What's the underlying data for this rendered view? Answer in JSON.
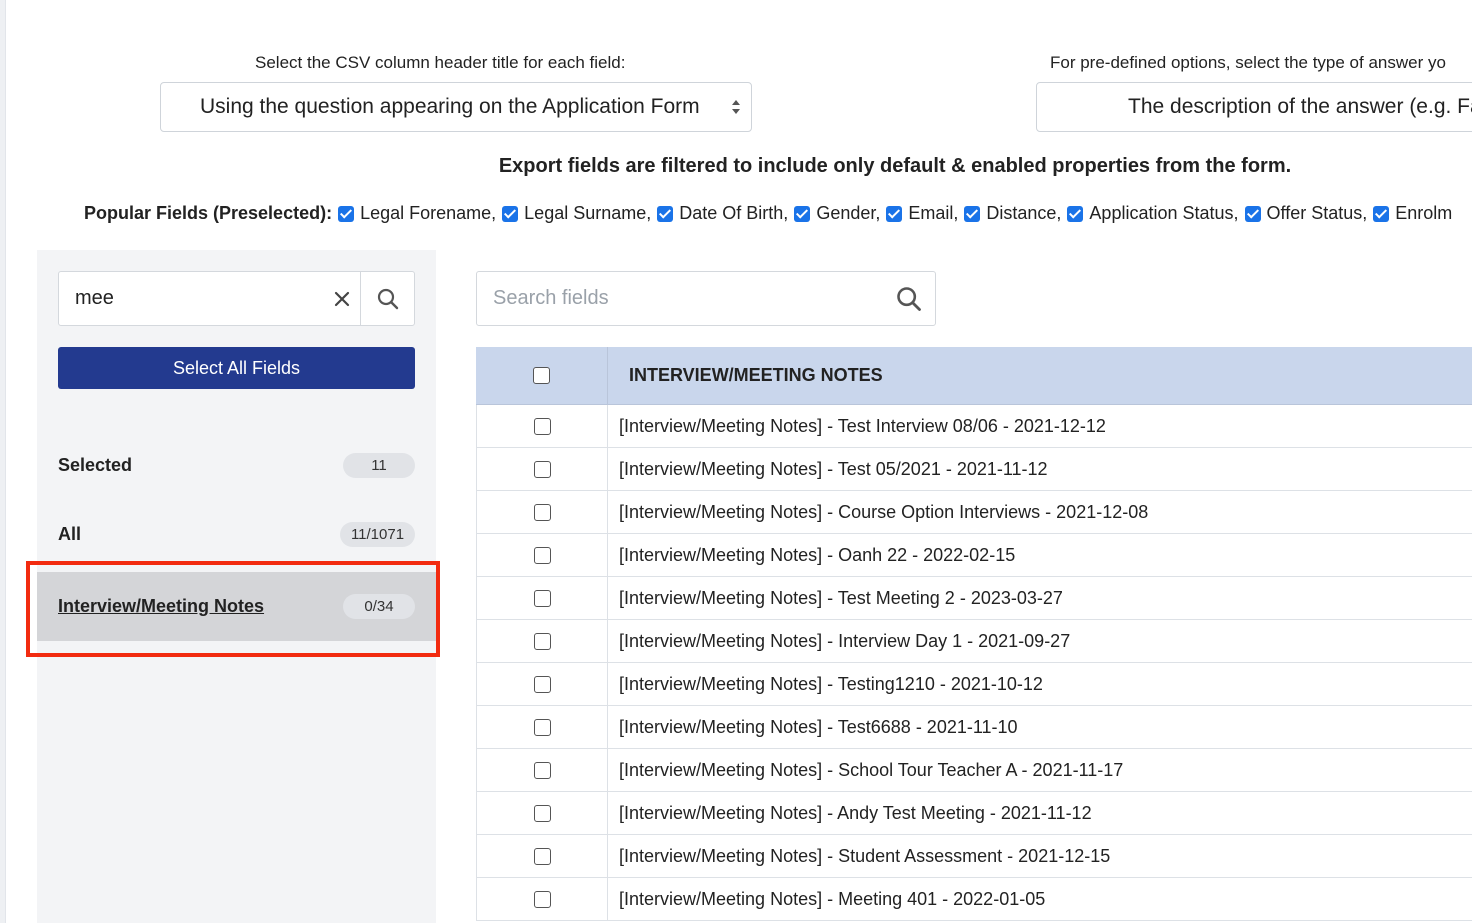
{
  "header": {
    "csv_label": "Select the CSV column header title for each field:",
    "csv_select_value": "Using the question appearing on the Application Form",
    "options_label": "For pre-defined options, select the type of answer yo",
    "options_select_value": "The description of the answer (e.g. Fa",
    "filter_note": "Export fields are filtered to include only default & enabled properties from the form."
  },
  "popular": {
    "title": "Popular Fields (Preselected):",
    "items": [
      {
        "label": "Legal Forename,",
        "checked": true
      },
      {
        "label": "Legal Surname,",
        "checked": true
      },
      {
        "label": "Date Of Birth,",
        "checked": true
      },
      {
        "label": "Gender,",
        "checked": true
      },
      {
        "label": "Email,",
        "checked": true
      },
      {
        "label": "Distance,",
        "checked": true
      },
      {
        "label": "Application Status,",
        "checked": true
      },
      {
        "label": "Offer Status,",
        "checked": true
      },
      {
        "label": "Enrolm",
        "checked": true
      }
    ]
  },
  "sidebar": {
    "search_value": "mee",
    "select_all_label": "Select All Fields",
    "categories": [
      {
        "label": "Selected",
        "count": "11"
      },
      {
        "label": "All",
        "count": "11/1071"
      },
      {
        "label": "Interview/Meeting Notes",
        "count": "0/34",
        "active": true
      }
    ]
  },
  "main": {
    "search_placeholder": "Search fields",
    "table_header": "INTERVIEW/MEETING NOTES",
    "rows": [
      {
        "label": "[Interview/Meeting Notes] - Test Interview 08/06 - 2021-12-12",
        "checked": false
      },
      {
        "label": "[Interview/Meeting Notes] - Test 05/2021 - 2021-11-12",
        "checked": false
      },
      {
        "label": "[Interview/Meeting Notes] - Course Option Interviews - 2021-12-08",
        "checked": false
      },
      {
        "label": "[Interview/Meeting Notes] - Oanh 22 - 2022-02-15",
        "checked": false
      },
      {
        "label": "[Interview/Meeting Notes] - Test Meeting 2 - 2023-03-27",
        "checked": false
      },
      {
        "label": "[Interview/Meeting Notes] - Interview Day 1 - 2021-09-27",
        "checked": false
      },
      {
        "label": "[Interview/Meeting Notes] - Testing1210 - 2021-10-12",
        "checked": false
      },
      {
        "label": "[Interview/Meeting Notes] - Test6688 - 2021-11-10",
        "checked": false
      },
      {
        "label": "[Interview/Meeting Notes] - School Tour Teacher A - 2021-11-17",
        "checked": false
      },
      {
        "label": "[Interview/Meeting Notes] - Andy Test Meeting - 2021-11-12",
        "checked": false
      },
      {
        "label": "[Interview/Meeting Notes] - Student Assessment - 2021-12-15",
        "checked": false
      },
      {
        "label": "[Interview/Meeting Notes] - Meeting 401 - 2022-01-05",
        "checked": false
      }
    ]
  },
  "colors": {
    "primary_button": "#233a8f",
    "table_header_bg": "#c9d6ec",
    "highlight_border": "#f22b10",
    "checkbox_checked": "#1a73e8"
  }
}
